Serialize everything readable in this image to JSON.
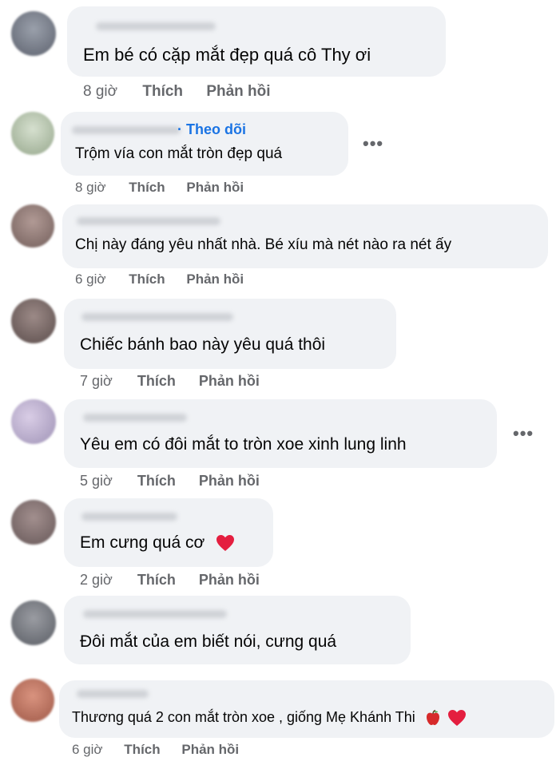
{
  "labels": {
    "like": "Thích",
    "reply": "Phản hồi",
    "follow": "· Theo dõi"
  },
  "colors": {
    "bubble": "#f0f2f5",
    "meta": "#65676b",
    "link": "#1b74e4",
    "heart": "#e41e3f"
  },
  "comments": [
    {
      "text": "Em bé có cặp mắt đẹp quá cô Thy ơi",
      "time": "8 giờ"
    },
    {
      "text": "Trộm vía con mắt tròn đẹp quá",
      "time": "8 giờ"
    },
    {
      "text": "Chị này đáng yêu nhất nhà. Bé xíu mà nét nào ra nét ấy",
      "time": "6 giờ"
    },
    {
      "text": "Chiếc bánh bao này yêu quá thôi",
      "time": "7 giờ"
    },
    {
      "text": "Yêu em có đôi mắt to tròn xoe xinh lung linh",
      "time": "5 giờ"
    },
    {
      "text": "Em cưng quá cơ",
      "time": "2 giờ"
    },
    {
      "text": "Đôi mắt của em biết nói, cưng quá",
      "time": ""
    },
    {
      "text": "Thương quá 2 con mắt tròn xoe , giống Mẹ Khánh Thi",
      "time": "6 giờ"
    }
  ]
}
